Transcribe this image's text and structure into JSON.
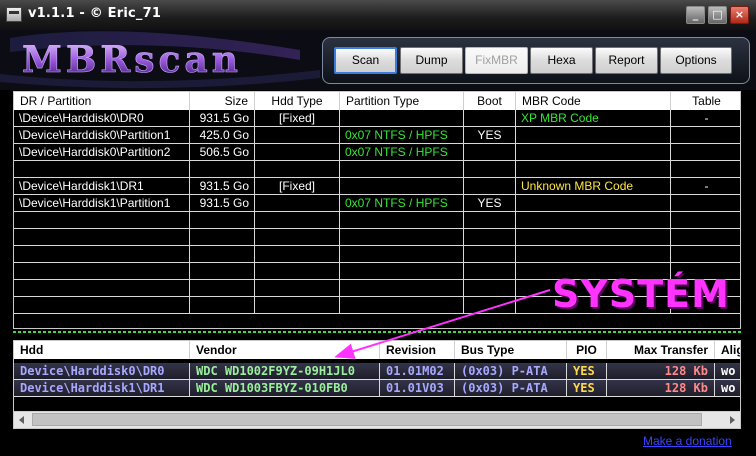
{
  "window": {
    "title": "v1.1.1 - © Eric_71"
  },
  "window_controls": {
    "minimize": "_",
    "maximize": "□",
    "close": "×"
  },
  "logo": {
    "text": "MBRscan"
  },
  "toolbar": {
    "scan": "Scan",
    "dump": "Dump",
    "fixmbr": "FixMBR",
    "hexa": "Hexa",
    "report": "Report",
    "options": "Options"
  },
  "partitions_table": {
    "columns": [
      "DR / Partition",
      "Size",
      "Hdd Type",
      "Partition Type",
      "Boot",
      "MBR Code",
      "Table"
    ],
    "rows": [
      [
        "\\Device\\Harddisk0\\DR0",
        "931.5 Go",
        "[Fixed]",
        "",
        "",
        "XP MBR Code",
        "-"
      ],
      [
        "\\Device\\Harddisk0\\Partition1",
        "425.0 Go",
        "",
        "0x07 NTFS / HPFS",
        "YES",
        "",
        ""
      ],
      [
        "\\Device\\Harddisk0\\Partition2",
        "506.5 Go",
        "",
        "0x07 NTFS / HPFS",
        "",
        "",
        ""
      ],
      [
        "",
        "",
        "",
        "",
        "",
        "",
        ""
      ],
      [
        "\\Device\\Harddisk1\\DR1",
        "931.5 Go",
        "[Fixed]",
        "",
        "",
        "Unknown MBR Code",
        "-"
      ],
      [
        "\\Device\\Harddisk1\\Partition1",
        "931.5 Go",
        "",
        "0x07 NTFS / HPFS",
        "YES",
        "",
        ""
      ]
    ]
  },
  "disks_table": {
    "columns": [
      "Hdd",
      "Vendor",
      "Revision",
      "Bus Type",
      "PIO",
      "Max Transfer",
      "Alig"
    ],
    "rows": [
      [
        "Device\\Harddisk0\\DR0",
        "WDC WD1002F9YZ-09H1JL0",
        "01.01M02",
        "(0x03)  P-ATA",
        "YES",
        "128 Kb",
        "wo"
      ],
      [
        "Device\\Harddisk1\\DR1",
        "WDC WD1003FBYZ-010FB0",
        "01.01V03",
        "(0x03)  P-ATA",
        "YES",
        "128 Kb",
        "wo"
      ]
    ]
  },
  "annotation": {
    "text": "SYSTÉM",
    "color": "#ff33ff"
  },
  "footer": {
    "donate": "Make a donation"
  },
  "colors": {
    "green_text": "#35e635",
    "yellow_text": "#ffe640",
    "accent_button": "#3b7bd9"
  }
}
